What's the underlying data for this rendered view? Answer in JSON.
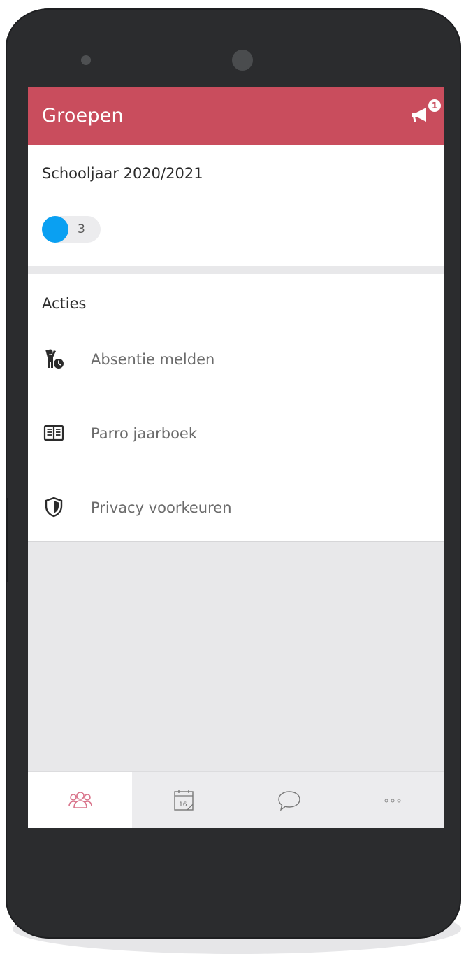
{
  "appbar": {
    "title": "Groepen",
    "announcement_badge": "1"
  },
  "school_year": {
    "title": "Schooljaar 2020/2021",
    "group_count": "3"
  },
  "actions": {
    "title": "Acties",
    "items": [
      {
        "label": "Absentie melden",
        "icon": "child-absence-icon"
      },
      {
        "label": "Parro jaarboek",
        "icon": "book-icon"
      },
      {
        "label": "Privacy voorkeuren",
        "icon": "shield-icon"
      }
    ]
  },
  "tabs": [
    {
      "icon": "groups-icon",
      "active": true
    },
    {
      "icon": "calendar-icon",
      "active": false,
      "calendar_day": "16"
    },
    {
      "icon": "chat-icon",
      "active": false
    },
    {
      "icon": "more-icon",
      "active": false
    }
  ],
  "colors": {
    "appbar": "#c94d5d",
    "group_dot": "#0aa0f2",
    "active_tab_icon": "#d9738a"
  }
}
